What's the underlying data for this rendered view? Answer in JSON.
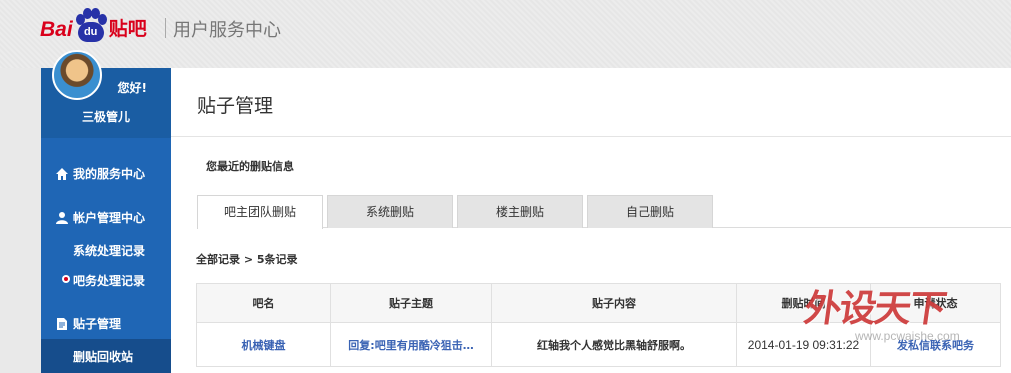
{
  "header": {
    "logo_bai": "Bai",
    "logo_du": "du",
    "logo_tieba": "贴吧",
    "title": "用户服务中心"
  },
  "sidebar": {
    "greeting": "您好!",
    "username": "三极管儿",
    "nav": [
      {
        "label": "我的服务中心",
        "icon": "home-icon"
      },
      {
        "label": "帐户管理中心",
        "icon": "user-icon"
      },
      {
        "label": "贴子管理",
        "icon": "document-icon"
      }
    ],
    "sub_items": [
      "系统处理记录",
      "吧务处理记录",
      "删贴回收站"
    ]
  },
  "main": {
    "title": "贴子管理",
    "section_label": "您最近的删贴信息",
    "tabs": [
      "吧主团队删贴",
      "系统删贴",
      "楼主删贴",
      "自己删贴"
    ],
    "records_label": "全部记录 > 5条记录",
    "table": {
      "headers": [
        "吧名",
        "贴子主题",
        "贴子内容",
        "删贴时间",
        "申请状态"
      ],
      "rows": [
        [
          "机械键盘",
          "回复:吧里有用酷冷狙击…",
          "红轴我个人感觉比黑轴舒服啊。",
          "2014-01-19 09:31:22",
          "发私信联系吧务"
        ]
      ]
    }
  },
  "watermark": {
    "text": "外设天下",
    "url": "www.pcwaishe.com"
  },
  "colors": {
    "brand_red": "#d9001b",
    "brand_blue": "#2732a8",
    "sidebar_blue": "#1f66b5",
    "link_blue": "#3a63b4"
  }
}
